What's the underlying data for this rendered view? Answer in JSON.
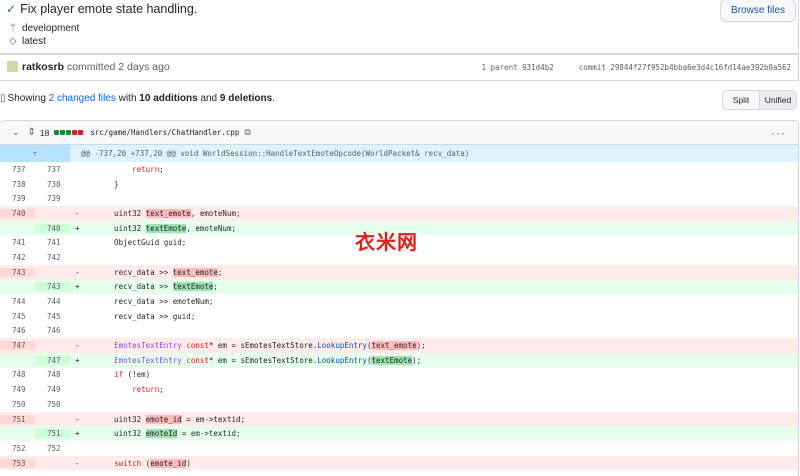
{
  "commit": {
    "title": "Fix player emote state handling.",
    "branch": "development",
    "tag": "latest",
    "browse_label": "Browse files",
    "author": "ratkosrb",
    "committed_text": "committed 2 days ago",
    "parent_label": "1 parent",
    "parent_sha": "931d4b2",
    "commit_label": "commit",
    "commit_sha": "29844f27f952b4bba6e3d4c16fd14ae392b0a562"
  },
  "stats": {
    "showing": "Showing",
    "changed_files": "2 changed files",
    "with": "with",
    "additions": "10 additions",
    "and": "and",
    "deletions": "9 deletions",
    "period": ".",
    "split_label": "Split",
    "unified_label": "Unified"
  },
  "file": {
    "changes_count": "18",
    "path": "src/game/Handlers/ChatHandler.cpp",
    "hunk_header": "@@ -737,20 +737,20 @@ void WorldSession::HandleTextEmoteOpcode(WorldPacket& recv_data)",
    "lines": [
      {
        "type": "ctx",
        "old": "737",
        "new": "737",
        "sign": "",
        "code": "        return;"
      },
      {
        "type": "ctx",
        "old": "738",
        "new": "738",
        "sign": "",
        "code": "    }"
      },
      {
        "type": "ctx",
        "old": "739",
        "new": "739",
        "sign": "",
        "code": ""
      },
      {
        "type": "del",
        "old": "740",
        "new": "",
        "sign": "-",
        "code": "    uint32 text_emote, emoteNum;"
      },
      {
        "type": "add",
        "old": "",
        "new": "740",
        "sign": "+",
        "code": "    uint32 textEmote, emoteNum;"
      },
      {
        "type": "ctx",
        "old": "741",
        "new": "741",
        "sign": "",
        "code": "    ObjectGuid guid;"
      },
      {
        "type": "ctx",
        "old": "742",
        "new": "742",
        "sign": "",
        "code": ""
      },
      {
        "type": "del",
        "old": "743",
        "new": "",
        "sign": "-",
        "code": "    recv_data >> text_emote;"
      },
      {
        "type": "add",
        "old": "",
        "new": "743",
        "sign": "+",
        "code": "    recv_data >> textEmote;"
      },
      {
        "type": "ctx",
        "old": "744",
        "new": "744",
        "sign": "",
        "code": "    recv_data >> emoteNum;"
      },
      {
        "type": "ctx",
        "old": "745",
        "new": "745",
        "sign": "",
        "code": "    recv_data >> guid;"
      },
      {
        "type": "ctx",
        "old": "746",
        "new": "746",
        "sign": "",
        "code": ""
      },
      {
        "type": "del",
        "old": "747",
        "new": "",
        "sign": "-",
        "code": "    EmotesTextEntry const* em = sEmotesTextStore.LookupEntry(text_emote);"
      },
      {
        "type": "add",
        "old": "",
        "new": "747",
        "sign": "+",
        "code": "    EmotesTextEntry const* em = sEmotesTextStore.LookupEntry(textEmote);"
      },
      {
        "type": "ctx",
        "old": "748",
        "new": "748",
        "sign": "",
        "code": "    if (!em)"
      },
      {
        "type": "ctx",
        "old": "749",
        "new": "749",
        "sign": "",
        "code": "        return;"
      },
      {
        "type": "ctx",
        "old": "750",
        "new": "750",
        "sign": "",
        "code": ""
      },
      {
        "type": "del",
        "old": "751",
        "new": "",
        "sign": "-",
        "code": "    uint32 emote_id = em->textid;"
      },
      {
        "type": "add",
        "old": "",
        "new": "751",
        "sign": "+",
        "code": "    uint32 emoteId = em->textid;"
      },
      {
        "type": "ctx",
        "old": "752",
        "new": "752",
        "sign": "",
        "code": ""
      },
      {
        "type": "del",
        "old": "753",
        "new": "",
        "sign": "-",
        "code": "    switch (emote_id)"
      }
    ],
    "highlights": [
      "text_emote",
      "textEmote",
      "emote_id",
      "emoteId"
    ]
  },
  "watermark": "衣米网",
  "colors": {
    "add_bg": "#e6ffec",
    "del_bg": "#ffebe9",
    "hunk_bg": "#ddf4ff",
    "link": "#0969da",
    "check": "#1a7f37"
  }
}
